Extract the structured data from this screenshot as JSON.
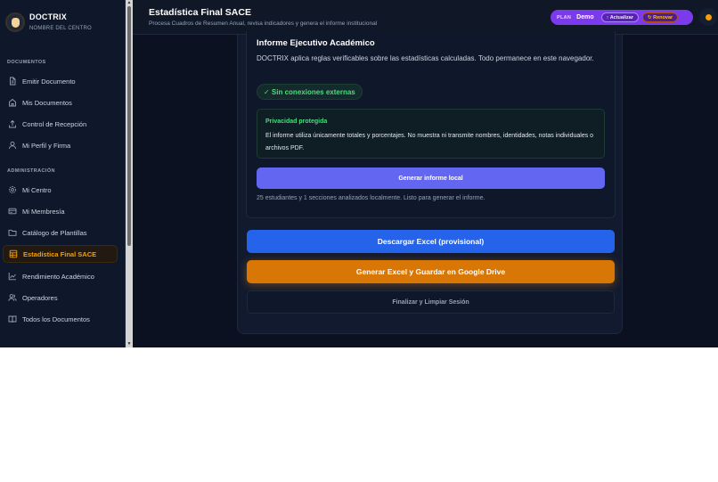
{
  "brand": {
    "name": "DOCTRIX",
    "subtitle": "NOMBRE DEL CENTRO"
  },
  "sidebar": {
    "sections": [
      {
        "title": "DOCUMENTOS"
      },
      {
        "title": "ADMINISTRACIÓN"
      }
    ],
    "items": [
      {
        "label": "Emitir Documento",
        "icon": "document-icon"
      },
      {
        "label": "Mis Documentos",
        "icon": "home-icon"
      },
      {
        "label": "Control de Recepción",
        "icon": "upload-icon"
      },
      {
        "label": "Mi Perfil y Firma",
        "icon": "user-icon"
      },
      {
        "label": "Mi Centro",
        "icon": "settings-icon"
      },
      {
        "label": "Mi Membresía",
        "icon": "card-icon"
      },
      {
        "label": "Catálogo de Plantillas",
        "icon": "folder-icon"
      },
      {
        "label": "Estadística Final SACE",
        "icon": "spreadsheet-icon",
        "active": true
      },
      {
        "label": "Rendimiento Académico",
        "icon": "chart-line-icon"
      },
      {
        "label": "Operadores",
        "icon": "users-icon"
      },
      {
        "label": "Todos los Documentos",
        "icon": "book-icon"
      }
    ]
  },
  "header": {
    "title": "Estadística Final SACE",
    "subtitle": "Procesa Cuadros de Resumen Anual, revisa indicadores y genera el informe institucional",
    "plan_tag": "PLAN",
    "plan_value": "Demo",
    "upgrade_label": "↑ Actualizar",
    "renew_label": "↻ Renovar"
  },
  "report": {
    "title": "Informe Ejecutivo Académico",
    "description": "DOCTRIX aplica reglas verificables sobre las estadísticas calculadas. Todo permanece en este navegador.",
    "badge": "✓ Sin conexiones externas",
    "privacy_title": "Privacidad protegida",
    "privacy_text": "El informe utiliza únicamente totales y porcentajes. No muestra ni transmite nombres, identidades, notas individuales o archivos PDF.",
    "generate_label": "Generar informe local",
    "status": "25 estudiantes y 1 secciones analizados localmente. Listo para generar el informe."
  },
  "actions": {
    "excel_label": "Descargar Excel (provisional)",
    "drive_label": "Generar Excel y Guardar en Google Drive",
    "finish_label": "Finalizar y Limpiar Sesión"
  },
  "colors": {
    "accent_active": "#f59e0b",
    "primary_blue": "#2563eb",
    "drive_orange": "#d97706",
    "generate_indigo": "#6366f1",
    "plan_purple": "#7c3aed",
    "success_green": "#4ade80"
  }
}
